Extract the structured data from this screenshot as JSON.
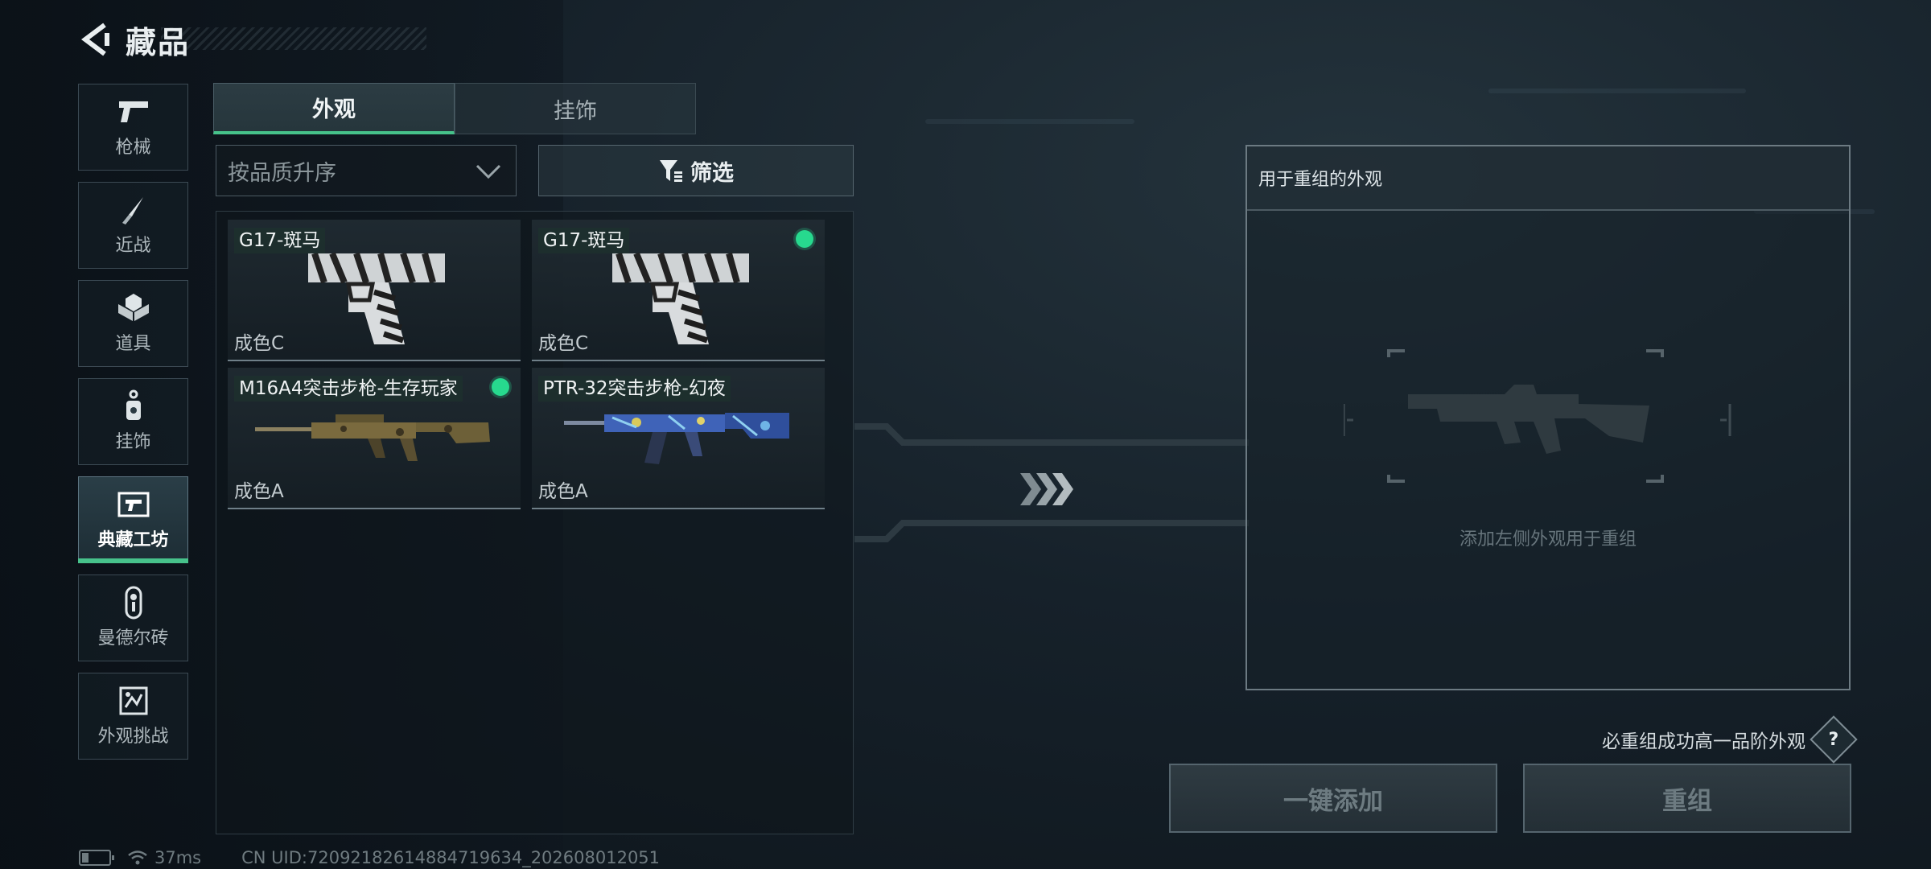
{
  "header": {
    "title": "藏品"
  },
  "sidebar": {
    "items": [
      {
        "label": "枪械",
        "icon": "pistol-icon"
      },
      {
        "label": "近战",
        "icon": "knife-icon"
      },
      {
        "label": "道具",
        "icon": "items-icon"
      },
      {
        "label": "挂饰",
        "icon": "charm-icon"
      },
      {
        "label": "典藏工坊",
        "icon": "workshop-icon",
        "active": true
      },
      {
        "label": "曼德尔砖",
        "icon": "mandel-brick-icon"
      },
      {
        "label": "外观挑战",
        "icon": "challenge-icon"
      }
    ]
  },
  "tabs": [
    {
      "label": "外观",
      "active": true
    },
    {
      "label": "挂饰",
      "active": false
    }
  ],
  "sort": {
    "label": "按品质升序"
  },
  "filter": {
    "label": "筛选"
  },
  "cards": [
    {
      "name": "G17-斑马",
      "grade": "成色C",
      "new_dot": false,
      "weapon": "pistol"
    },
    {
      "name": "G17-斑马",
      "grade": "成色C",
      "new_dot": true,
      "weapon": "pistol"
    },
    {
      "name": "M16A4突击步枪-生存玩家",
      "grade": "成色A",
      "new_dot": true,
      "weapon": "rifle-camo"
    },
    {
      "name": "PTR-32突击步枪-幻夜",
      "grade": "成色A",
      "new_dot": false,
      "weapon": "rifle-blue"
    }
  ],
  "recompose": {
    "header": "用于重组的外观",
    "placeholder": "添加左侧外观用于重组",
    "guarantee": "必重组成功高一品阶外观",
    "help": "?"
  },
  "buttons": {
    "add_all": "一键添加",
    "recompose": "重组"
  },
  "status": {
    "ping": "37ms",
    "uid": "CN UID:72092182614884719634_202608012051"
  },
  "colors": {
    "accent_green": "#46c28a",
    "new_dot": "#27d98e"
  }
}
